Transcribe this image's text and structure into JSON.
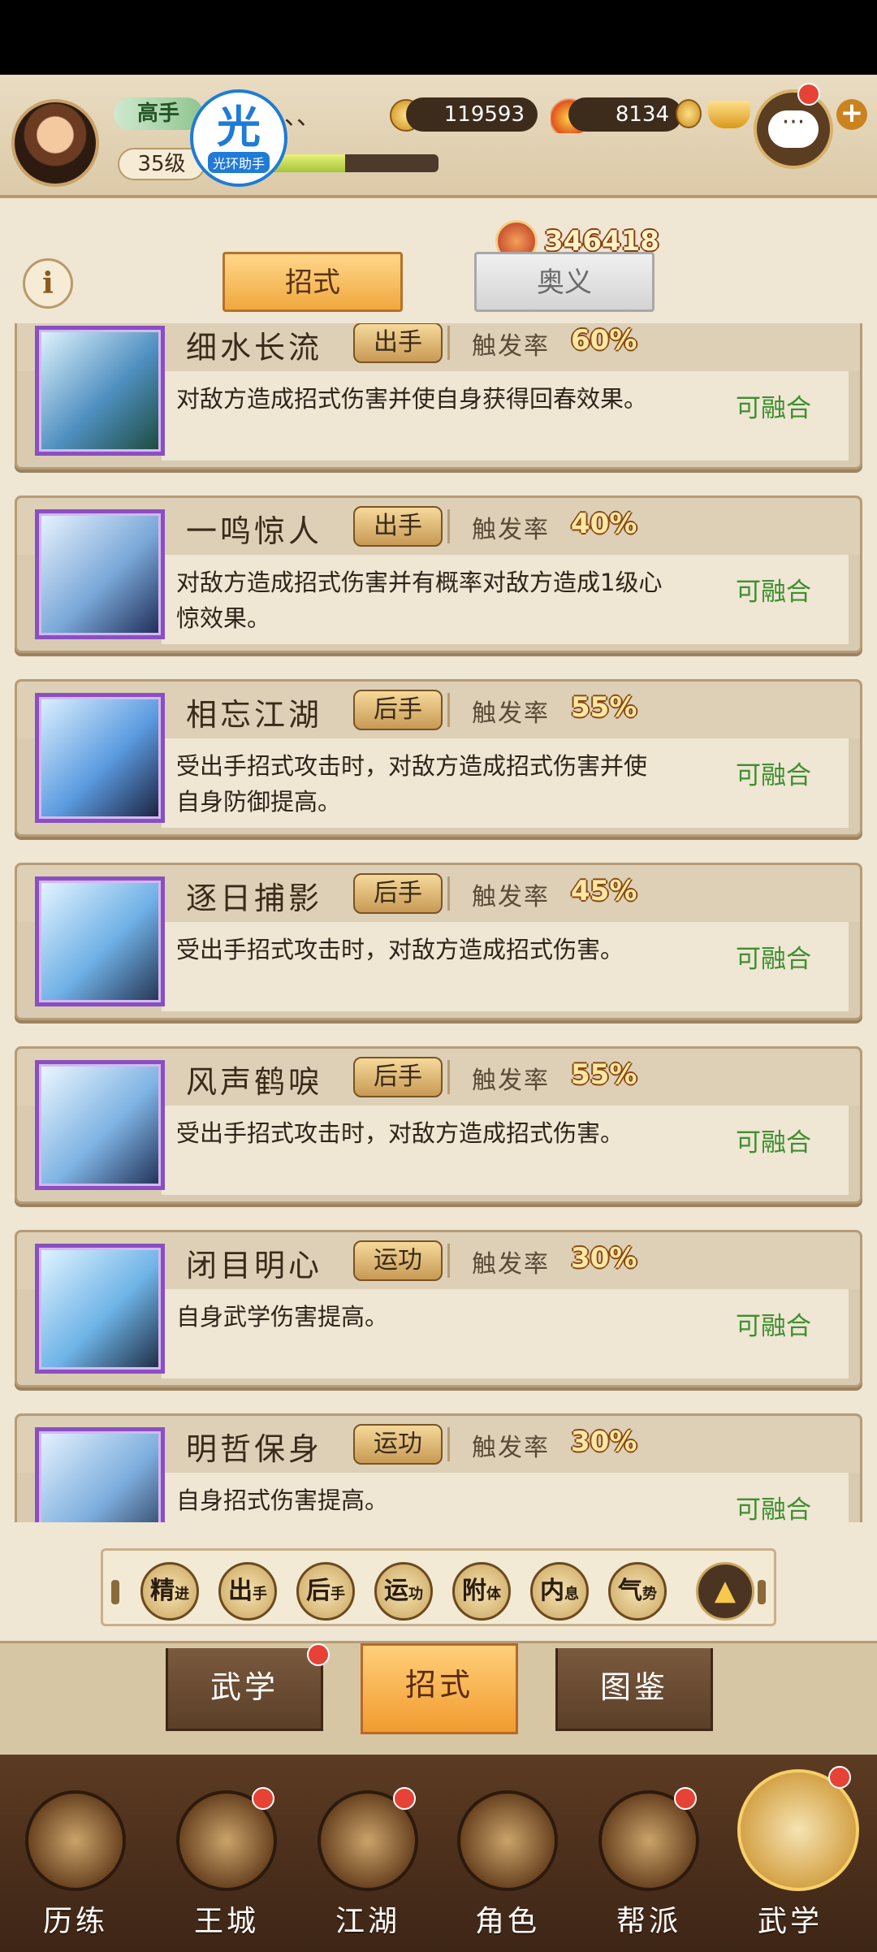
{
  "header": {
    "rank_title": "高手",
    "level": "35级",
    "name_fragment": "、、",
    "exp_fraction": 0.52,
    "coins": "119593",
    "fire_currency": "8134",
    "combat_power": "346418",
    "helper_logo_char": "光",
    "helper_logo_text": "光环助手",
    "chat_icon_text": "···"
  },
  "info_button": "i",
  "top_tabs": [
    {
      "label": "招式",
      "active": true
    },
    {
      "label": "奥义",
      "active": false
    }
  ],
  "rate_label": "触发率",
  "skills": [
    {
      "name": "细水长流",
      "type": "出手",
      "rate": "60%",
      "desc": "对敌方造成招式伤害并使自身获得回春效果。",
      "status": "可融合",
      "colors": [
        "#e3f6ff",
        "#4f8fc0",
        "#1c4a3a"
      ]
    },
    {
      "name": "一鸣惊人",
      "type": "出手",
      "rate": "40%",
      "desc": "对敌方造成招式伤害并有概率对敌方造成1级心惊效果。",
      "status": "可融合",
      "colors": [
        "#eaf4ff",
        "#7aa8d8",
        "#1d2a55"
      ]
    },
    {
      "name": "相忘江湖",
      "type": "后手",
      "rate": "55%",
      "desc": "受出手招式攻击时，对敌方造成招式伤害并使自身防御提高。",
      "status": "可融合",
      "colors": [
        "#dff2ff",
        "#5b9be0",
        "#1a1f3a"
      ]
    },
    {
      "name": "逐日捕影",
      "type": "后手",
      "rate": "45%",
      "desc": "受出手招式攻击时，对敌方造成招式伤害。",
      "status": "可融合",
      "colors": [
        "#e6f6ff",
        "#6fb0e6",
        "#23324f"
      ]
    },
    {
      "name": "风声鹤唳",
      "type": "后手",
      "rate": "55%",
      "desc": "受出手招式攻击时，对敌方造成招式伤害。",
      "status": "可融合",
      "colors": [
        "#eef8ff",
        "#7fb4e4",
        "#1f2f55"
      ]
    },
    {
      "name": "闭目明心",
      "type": "运功",
      "rate": "30%",
      "desc": "自身武学伤害提高。",
      "status": "可融合",
      "colors": [
        "#e4f5ff",
        "#6fb4e8",
        "#1c2a40"
      ]
    },
    {
      "name": "明哲保身",
      "type": "运功",
      "rate": "30%",
      "desc": "自身招式伤害提高。",
      "status": "可融合",
      "colors": [
        "#e7f4ff",
        "#7eaede",
        "#24324f"
      ]
    }
  ],
  "filters": [
    {
      "main": "精",
      "sub": "进"
    },
    {
      "main": "出",
      "sub": "手"
    },
    {
      "main": "后",
      "sub": "手"
    },
    {
      "main": "运",
      "sub": "功"
    },
    {
      "main": "附",
      "sub": "体"
    },
    {
      "main": "内",
      "sub": "息"
    },
    {
      "main": "气",
      "sub": "势"
    }
  ],
  "filter_up_icon": "chevron-up-icon",
  "bottom_tabs": [
    {
      "label": "武学",
      "active": false,
      "badge": true
    },
    {
      "label": "招式",
      "active": true,
      "badge": false
    },
    {
      "label": "图鉴",
      "active": false,
      "badge": false
    }
  ],
  "nav": [
    {
      "label": "历练",
      "icon": "training-icon",
      "badge": false
    },
    {
      "label": "王城",
      "icon": "palace-icon",
      "badge": true
    },
    {
      "label": "江湖",
      "icon": "jianghu-icon",
      "badge": true
    },
    {
      "label": "角色",
      "icon": "character-icon",
      "badge": false
    },
    {
      "label": "帮派",
      "icon": "guild-icon",
      "badge": true
    },
    {
      "label": "武学",
      "icon": "martial-arts-icon",
      "badge": true,
      "active": true
    }
  ],
  "colors": {
    "fusible": "#3e8f2e",
    "badge_red": "#e64236",
    "skill_frame": "#8a4fc2",
    "active_tab": "#f0a83e"
  }
}
